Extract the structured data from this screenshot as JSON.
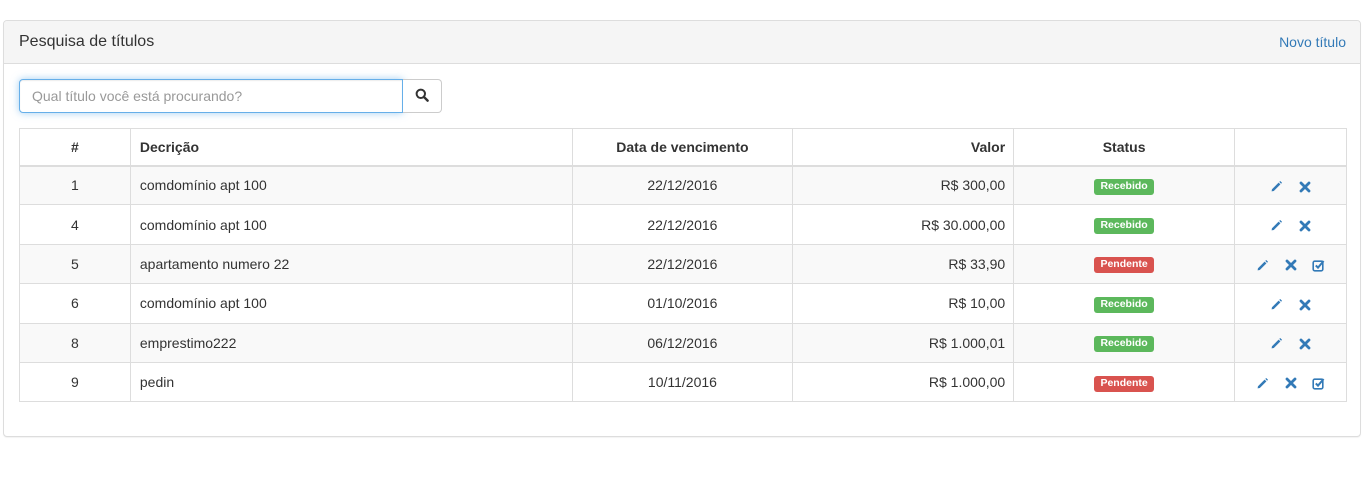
{
  "panel": {
    "title": "Pesquisa de títulos",
    "new_link": "Novo título"
  },
  "search": {
    "placeholder": "Qual título você está procurando?",
    "value": ""
  },
  "table": {
    "headers": {
      "id": "#",
      "description": "Decrição",
      "due_date": "Data de vencimento",
      "value": "Valor",
      "status": "Status",
      "actions": ""
    },
    "rows": [
      {
        "id": "1",
        "description": "comdomínio apt 100",
        "due_date": "22/12/2016",
        "value": "R$ 300,00",
        "status": "Recebido",
        "can_receive": false
      },
      {
        "id": "4",
        "description": "comdomínio apt 100",
        "due_date": "22/12/2016",
        "value": "R$ 30.000,00",
        "status": "Recebido",
        "can_receive": false
      },
      {
        "id": "5",
        "description": "apartamento numero 22",
        "due_date": "22/12/2016",
        "value": "R$ 33,90",
        "status": "Pendente",
        "can_receive": true
      },
      {
        "id": "6",
        "description": "comdomínio apt 100",
        "due_date": "01/10/2016",
        "value": "R$ 10,00",
        "status": "Recebido",
        "can_receive": false
      },
      {
        "id": "8",
        "description": "emprestimo222",
        "due_date": "06/12/2016",
        "value": "R$ 1.000,01",
        "status": "Recebido",
        "can_receive": false
      },
      {
        "id": "9",
        "description": "pedin",
        "due_date": "10/11/2016",
        "value": "R$ 1.000,00",
        "status": "Pendente",
        "can_receive": true
      }
    ]
  },
  "colors": {
    "link": "#337ab7",
    "received": "#5cb85c",
    "pending": "#d9534f",
    "icon": "#337ab7"
  },
  "icons": {
    "search": "search-icon",
    "edit": "pencil-icon",
    "delete": "close-icon",
    "receive": "check-square-icon"
  }
}
